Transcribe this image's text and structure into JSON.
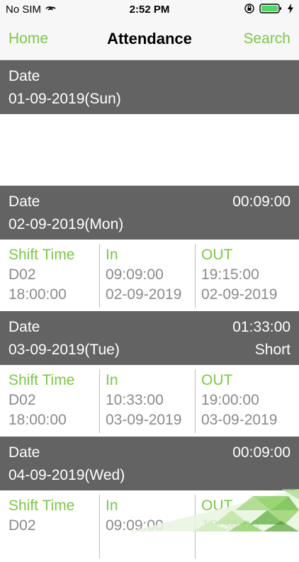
{
  "status_bar": {
    "carrier": "No SIM",
    "time": "2:52 PM"
  },
  "nav": {
    "home": "Home",
    "title": "Attendance",
    "search": "Search"
  },
  "date_label": "Date",
  "col_labels": {
    "shift": "Shift Time",
    "in": "In",
    "out": "OUT"
  },
  "records": [
    {
      "date": "01-09-2019(Sun)",
      "duration": "",
      "status": ""
    },
    {
      "date": "02-09-2019(Mon)",
      "duration": "00:09:00",
      "status": "",
      "shift_code": "D02",
      "shift_time": "18:00:00",
      "in_time": "09:09:00",
      "in_date": "02-09-2019",
      "out_time": "19:15:00",
      "out_date": "02-09-2019"
    },
    {
      "date": "03-09-2019(Tue)",
      "duration": "01:33:00",
      "status": "Short",
      "shift_code": "D02",
      "shift_time": "18:00:00",
      "in_time": "10:33:00",
      "in_date": "03-09-2019",
      "out_time": "19:00:00",
      "out_date": "03-09-2019"
    },
    {
      "date": "04-09-2019(Wed)",
      "duration": "00:09:00",
      "status": "",
      "shift_code": "D02",
      "shift_time": "",
      "in_time": "09:09:00",
      "in_date": "",
      "out_time": "18:34:00",
      "out_date": ""
    }
  ],
  "colors": {
    "accent": "#7ac943",
    "header_bg": "#636363",
    "muted_text": "#8a8a8a"
  }
}
